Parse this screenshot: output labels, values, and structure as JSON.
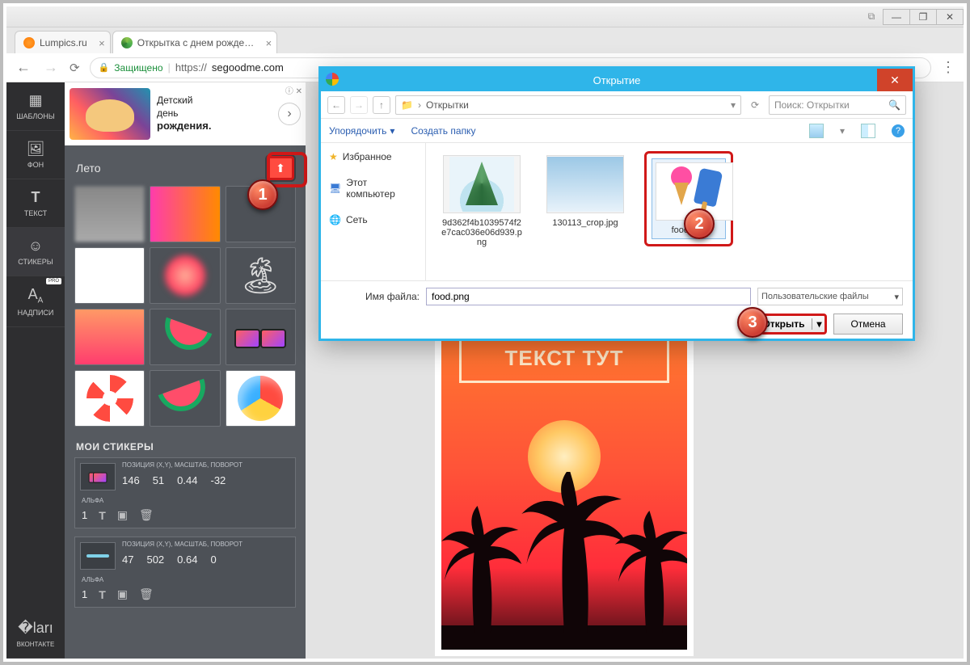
{
  "window_buttons": {
    "min": "—",
    "max": "❐",
    "close": "✕"
  },
  "tabs": [
    {
      "title": "Lumpics.ru"
    },
    {
      "title": "Открытка с днем рожде…"
    }
  ],
  "address_bar": {
    "secure_label": "Защищено",
    "url_prefix": "https://",
    "url_host": "segoodme.com"
  },
  "rail": {
    "templates": "ШАБЛОНЫ",
    "background": "ФОН",
    "text": "ТЕКСТ",
    "stickers": "СТИКЕРЫ",
    "captions": "НАДПИСИ",
    "pro": "PRO",
    "vk": "ВКОНТАКТЕ"
  },
  "ad": {
    "line1": "Детский",
    "line2": "день",
    "line3": "рождения.",
    "info": "ⓘ ✕"
  },
  "panel": {
    "category_title": "Лето",
    "my_stickers_title": "МОИ СТИКЕРЫ",
    "prop_label": "ПОЗИЦИЯ (X,Y), МАСШТАБ, ПОВОРОТ",
    "alpha_label": "АЛЬФА",
    "stickers_instances": [
      {
        "x": "146",
        "y": "51",
        "scale": "0.44",
        "rot": "-32",
        "alpha": "1"
      },
      {
        "x": "47",
        "y": "502",
        "scale": "0.64",
        "rot": "0",
        "alpha": "1"
      }
    ]
  },
  "canvas": {
    "placeholder_text": "ТЕКСТ ТУТ"
  },
  "dialog": {
    "title": "Открытие",
    "breadcrumb_folder": "Открытки",
    "search_placeholder": "Поиск: Открытки",
    "organize": "Упорядочить",
    "new_folder": "Создать папку",
    "nav": {
      "favorites": "Избранное",
      "this_pc": "Этот компьютер",
      "network": "Сеть"
    },
    "files": [
      {
        "name": "9d362f4b1039574f2e7cac036e06d939.png"
      },
      {
        "name": "130113_crop.jpg"
      },
      {
        "name": "food.png",
        "selected": true
      }
    ],
    "filename_label": "Имя файла:",
    "filename_value": "food.png",
    "filetype": "Пользовательские файлы",
    "open_btn": "Открыть",
    "cancel_btn": "Отмена"
  },
  "callouts": {
    "c1": "1",
    "c2": "2",
    "c3": "3"
  }
}
